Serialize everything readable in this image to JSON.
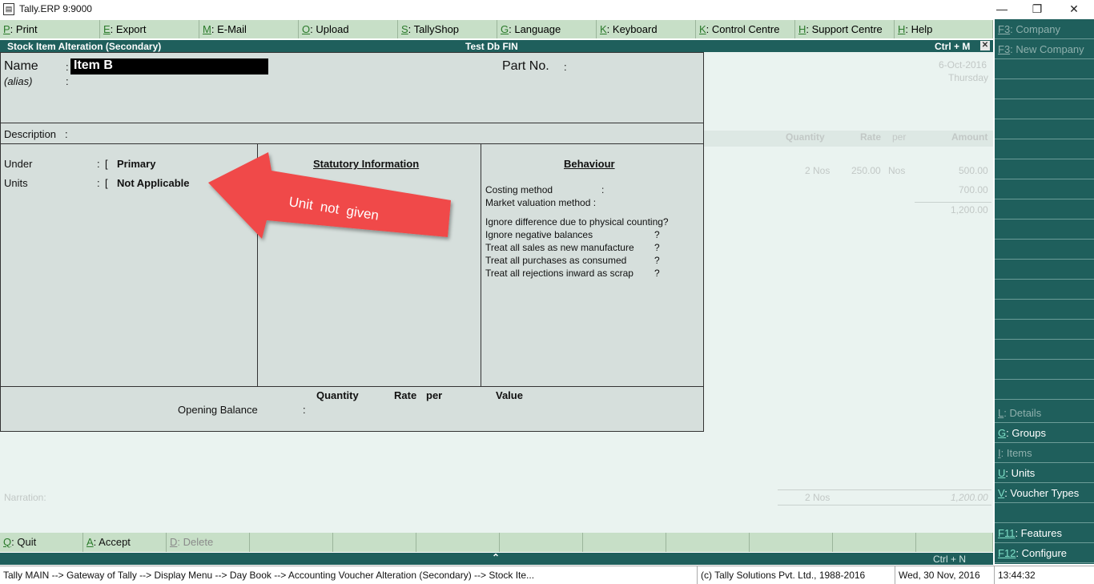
{
  "window": {
    "title": "Tally.ERP 9:9000",
    "minimize": "—",
    "restore": "❐",
    "close": "✕"
  },
  "top_buttons": [
    {
      "key": "P",
      "label": ": Print",
      "dim": true
    },
    {
      "key": "E",
      "label": ": Export",
      "dim": true
    },
    {
      "key": "M",
      "label": ": E-Mail",
      "dim": true
    },
    {
      "key": "O",
      "label": ": Upload",
      "dim": true
    },
    {
      "key": "S",
      "label": ": TallyShop",
      "dim": false
    },
    {
      "key": "G",
      "label": ": Language",
      "dim": true
    },
    {
      "key": "K",
      "label": ": Keyboard",
      "dim": false
    },
    {
      "key": "K",
      "label": ": Control Centre",
      "dim": false
    },
    {
      "key": "H",
      "label": ": Support Centre",
      "dim": false
    },
    {
      "key": "H",
      "label": ": Help",
      "dim": false
    }
  ],
  "header": {
    "title": "Stock Item Alteration (Secondary)",
    "company": "Test Db FIN",
    "shortcut": "Ctrl + M",
    "close": "✕"
  },
  "form": {
    "name_label": "Name",
    "name_value": "Item B",
    "alias_label": "(alias)",
    "partno_label": "Part No.",
    "description_label": "Description",
    "under_label": "Under",
    "under_value": "Primary",
    "units_label": "Units",
    "units_value": "Not Applicable",
    "statutory_title": "Statutory Information",
    "behaviour_title": "Behaviour",
    "behaviour_items": [
      "Costing method",
      "Market valuation method :",
      "Ignore difference due to physical counting?",
      "Ignore negative balances",
      "Treat all sales as new manufacture",
      "Treat all purchases as consumed",
      "Treat all rejections inward as scrap"
    ],
    "colon": ":",
    "qmark": "?",
    "quantity_label": "Quantity",
    "rate_label": "Rate",
    "per_label": "per",
    "value_label": "Value",
    "opening_label": "Opening Balance"
  },
  "annotation": {
    "text": "Unit  not  given",
    "color": "#f04848"
  },
  "background": {
    "date": "6-Oct-2016",
    "day": "Thursday",
    "col_quantity": "Quantity",
    "col_rate": "Rate",
    "col_per": "per",
    "col_amount": "Amount",
    "row_qty": "2 Nos",
    "row_rate": "250.00",
    "row_unit": "Nos",
    "row_amount": "500.00",
    "amount2": "700.00",
    "total": "1,200.00",
    "narration": "Narration:",
    "footer_qty": "2 Nos",
    "footer_total": "1,200.00"
  },
  "right_panel": [
    {
      "key": "F3",
      "label": ": Company",
      "dim": true
    },
    {
      "key": "F3",
      "label": ": New Company",
      "dim": true
    },
    {
      "key": "L",
      "label": ": Details",
      "dim": true
    },
    {
      "key": "G",
      "label": ": Groups",
      "dim": false
    },
    {
      "key": "I",
      "label": ": Items",
      "dim": true
    },
    {
      "key": "U",
      "label": ": Units",
      "dim": false
    },
    {
      "key": "V",
      "label": ": Voucher Types",
      "dim": false
    },
    {
      "key": "F11",
      "label": ": Features",
      "dim": false
    },
    {
      "key": "F12",
      "label": ": Configure",
      "dim": false
    }
  ],
  "bottom_buttons": [
    {
      "key": "Q",
      "label": ": Quit",
      "dim": false
    },
    {
      "key": "A",
      "label": ": Accept",
      "dim": false
    },
    {
      "key": "D",
      "label": ": Delete",
      "dim": true
    }
  ],
  "bottom_strip": {
    "shortcut": "Ctrl + N",
    "arrow": "⌃"
  },
  "status": {
    "path": "Tally MAIN --> Gateway of Tally --> Display Menu --> Day Book --> Accounting Voucher  Alteration  (Secondary) --> Stock Ite...",
    "copyright": "(c) Tally Solutions Pvt. Ltd., 1988-2016",
    "date": "Wed, 30 Nov, 2016",
    "time": "13:44:32"
  }
}
